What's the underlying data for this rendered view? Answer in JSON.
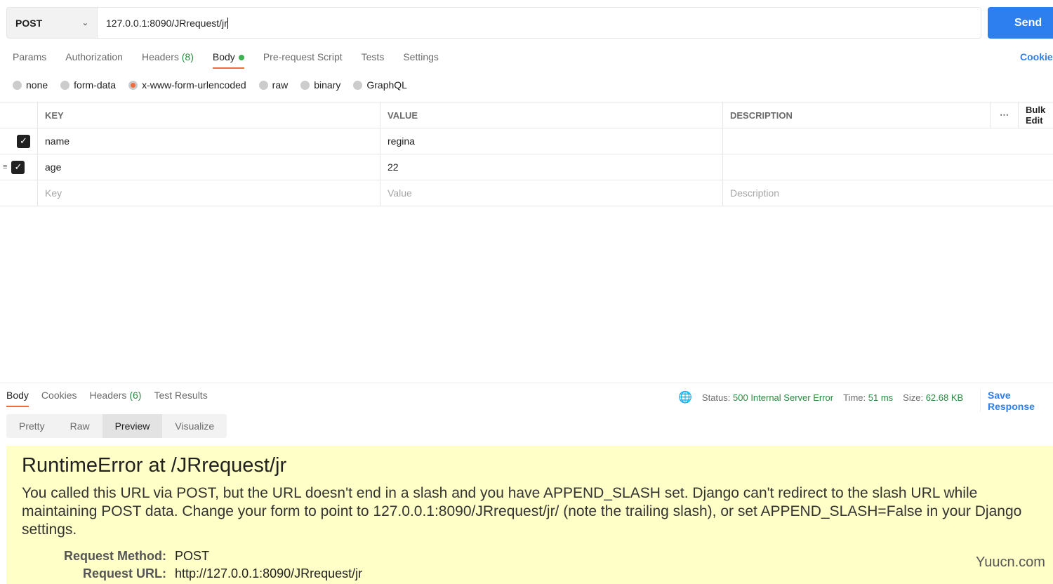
{
  "request": {
    "method": "POST",
    "url": "127.0.0.1:8090/JRrequest/jr",
    "send": "Send"
  },
  "tabs": {
    "params": "Params",
    "authorization": "Authorization",
    "headers": "Headers",
    "headers_count": "(8)",
    "body": "Body",
    "prerequest": "Pre-request Script",
    "tests": "Tests",
    "settings": "Settings",
    "cookies": "Cookies"
  },
  "body_types": [
    "none",
    "form-data",
    "x-www-form-urlencoded",
    "raw",
    "binary",
    "GraphQL"
  ],
  "table": {
    "headers": [
      "KEY",
      "VALUE",
      "DESCRIPTION"
    ],
    "bulk": "Bulk Edit",
    "rows": [
      {
        "key": "name",
        "value": "regina",
        "description": ""
      },
      {
        "key": "age",
        "value": "22",
        "description": ""
      }
    ],
    "placeholders": {
      "key": "Key",
      "value": "Value",
      "description": "Description"
    }
  },
  "response": {
    "tabs": {
      "body": "Body",
      "cookies": "Cookies",
      "headers": "Headers",
      "headers_count": "(6)",
      "tests": "Test Results"
    },
    "status_label": "Status:",
    "status": "500 Internal Server Error",
    "time_label": "Time:",
    "time": "51 ms",
    "size_label": "Size:",
    "size": "62.68 KB",
    "save": "Save Response",
    "views": [
      "Pretty",
      "Raw",
      "Preview",
      "Visualize"
    ]
  },
  "preview": {
    "title": "RuntimeError at /JRrequest/jr",
    "message": "You called this URL via POST, but the URL doesn't end in a slash and you have APPEND_SLASH set. Django can't redirect to the slash URL while maintaining POST data. Change your form to point to 127.0.0.1:8090/JRrequest/jr/ (note the trailing slash), or set APPEND_SLASH=False in your Django settings.",
    "method_label": "Request Method:",
    "method": "POST",
    "url_label": "Request URL:",
    "url": "http://127.0.0.1:8090/JRrequest/jr"
  },
  "watermark": "Yuucn.com"
}
